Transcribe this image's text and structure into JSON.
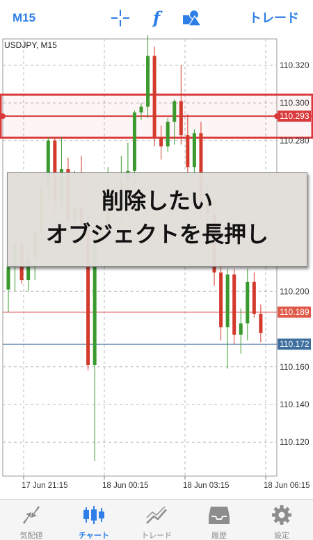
{
  "toolbar": {
    "timeframe": "M15",
    "func_glyph": "f",
    "trade_label": "トレード",
    "icons": [
      "crosshair-icon",
      "function-icon",
      "objects-icon"
    ],
    "accent": "#2f7fe6"
  },
  "chart": {
    "symbol_label": "USDJPY, M15",
    "price_axis": [
      "110.320",
      "110.300",
      "110.280",
      "110.200",
      "110.160",
      "110.140",
      "110.120"
    ],
    "time_axis": [
      "17 Jun 21:15",
      "18 Jun 00:15",
      "18 Jun 03:15",
      "18 Jun 06:15"
    ],
    "hline_selected": {
      "price": "110.293",
      "color": "#d9393a"
    },
    "hline_bid": {
      "price": "110.189",
      "color": "#e06060"
    },
    "hline_ask": {
      "price": "110.172",
      "color": "#3d6e9e"
    },
    "colors": {
      "bull": "#3a9a2e",
      "bear": "#d33a2c",
      "grid": "#b8b8b8"
    }
  },
  "chart_data": {
    "type": "candlestick",
    "symbol": "USDJPY",
    "timeframe": "M15",
    "ylim": [
      110.102,
      110.334
    ],
    "y_ticks": [
      110.32,
      110.3,
      110.28,
      110.2,
      110.16,
      110.14,
      110.12
    ],
    "x_ticks": [
      "17 Jun 21:15",
      "18 Jun 00:15",
      "18 Jun 03:15",
      "18 Jun 06:15"
    ],
    "horizontal_lines": [
      {
        "price": 110.293,
        "selected": true
      },
      {
        "price": 110.189
      },
      {
        "price": 110.172
      }
    ],
    "candles": [
      {
        "o": 110.201,
        "h": 110.214,
        "l": 110.189,
        "c": 110.213
      },
      {
        "o": 110.213,
        "h": 110.237,
        "l": 110.2,
        "c": 110.225
      },
      {
        "o": 110.225,
        "h": 110.232,
        "l": 110.204,
        "c": 110.206
      },
      {
        "o": 110.206,
        "h": 110.224,
        "l": 110.2,
        "c": 110.218
      },
      {
        "o": 110.218,
        "h": 110.236,
        "l": 110.206,
        "c": 110.232
      },
      {
        "o": 110.232,
        "h": 110.259,
        "l": 110.226,
        "c": 110.255
      },
      {
        "o": 110.255,
        "h": 110.282,
        "l": 110.25,
        "c": 110.28
      },
      {
        "o": 110.28,
        "h": 110.282,
        "l": 110.241,
        "c": 110.248
      },
      {
        "o": 110.248,
        "h": 110.282,
        "l": 110.244,
        "c": 110.265
      },
      {
        "o": 110.265,
        "h": 110.271,
        "l": 110.231,
        "c": 110.238
      },
      {
        "o": 110.238,
        "h": 110.264,
        "l": 110.234,
        "c": 110.244
      },
      {
        "o": 110.244,
        "h": 110.272,
        "l": 110.228,
        "c": 110.233
      },
      {
        "o": 110.233,
        "h": 110.241,
        "l": 110.158,
        "c": 110.161
      },
      {
        "o": 110.161,
        "h": 110.239,
        "l": 110.11,
        "c": 110.228
      },
      {
        "o": 110.228,
        "h": 110.243,
        "l": 110.222,
        "c": 110.235
      },
      {
        "o": 110.235,
        "h": 110.266,
        "l": 110.227,
        "c": 110.246
      },
      {
        "o": 110.246,
        "h": 110.252,
        "l": 110.238,
        "c": 110.244
      },
      {
        "o": 110.244,
        "h": 110.272,
        "l": 110.236,
        "c": 110.259
      },
      {
        "o": 110.259,
        "h": 110.279,
        "l": 110.25,
        "c": 110.264
      },
      {
        "o": 110.264,
        "h": 110.296,
        "l": 110.255,
        "c": 110.295
      },
      {
        "o": 110.295,
        "h": 110.3,
        "l": 110.291,
        "c": 110.298
      },
      {
        "o": 110.298,
        "h": 110.336,
        "l": 110.292,
        "c": 110.325
      },
      {
        "o": 110.325,
        "h": 110.33,
        "l": 110.277,
        "c": 110.282
      },
      {
        "o": 110.282,
        "h": 110.288,
        "l": 110.27,
        "c": 110.277
      },
      {
        "o": 110.277,
        "h": 110.292,
        "l": 110.274,
        "c": 110.29
      },
      {
        "o": 110.29,
        "h": 110.302,
        "l": 110.278,
        "c": 110.301
      },
      {
        "o": 110.301,
        "h": 110.32,
        "l": 110.278,
        "c": 110.283
      },
      {
        "o": 110.283,
        "h": 110.294,
        "l": 110.261,
        "c": 110.266
      },
      {
        "o": 110.266,
        "h": 110.286,
        "l": 110.262,
        "c": 110.284
      },
      {
        "o": 110.284,
        "h": 110.29,
        "l": 110.24,
        "c": 110.246
      },
      {
        "o": 110.246,
        "h": 110.255,
        "l": 110.236,
        "c": 110.241
      },
      {
        "o": 110.241,
        "h": 110.248,
        "l": 110.203,
        "c": 110.21
      },
      {
        "o": 110.21,
        "h": 110.216,
        "l": 110.174,
        "c": 110.181
      },
      {
        "o": 110.181,
        "h": 110.212,
        "l": 110.159,
        "c": 110.209
      },
      {
        "o": 110.209,
        "h": 110.212,
        "l": 110.172,
        "c": 110.177
      },
      {
        "o": 110.177,
        "h": 110.191,
        "l": 110.167,
        "c": 110.183
      },
      {
        "o": 110.183,
        "h": 110.212,
        "l": 110.174,
        "c": 110.205
      },
      {
        "o": 110.205,
        "h": 110.21,
        "l": 110.186,
        "c": 110.188
      },
      {
        "o": 110.188,
        "h": 110.193,
        "l": 110.173,
        "c": 110.178
      }
    ]
  },
  "overlay": {
    "line1": "削除したい",
    "line2": "オブジェクトを長押し"
  },
  "bottom_nav": [
    {
      "label": "気配値",
      "icon": "quotes-icon",
      "active": false
    },
    {
      "label": "チャート",
      "icon": "chart-icon",
      "active": true
    },
    {
      "label": "トレード",
      "icon": "trade-icon",
      "active": false
    },
    {
      "label": "履歴",
      "icon": "history-icon",
      "active": false
    },
    {
      "label": "設定",
      "icon": "settings-icon",
      "active": false
    }
  ]
}
